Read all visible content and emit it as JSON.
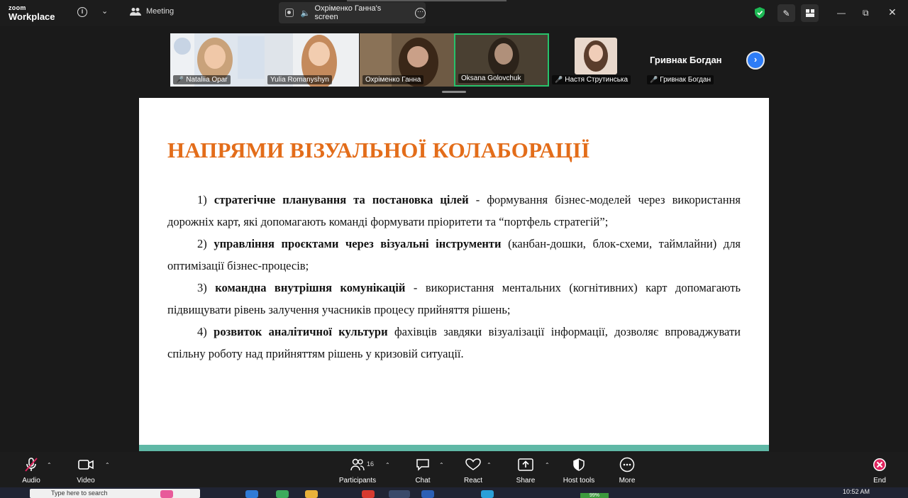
{
  "topbar": {
    "app_small": "zoom",
    "app_name": "Workplace",
    "meeting_label": "Meeting",
    "screen_title": "Охріменко Ганна's screen"
  },
  "gallery": {
    "tiles": [
      {
        "name": "Nataliia Opar",
        "muted": true
      },
      {
        "name": "Yulia Romanyshyn",
        "muted": false
      },
      {
        "name": "Охріменко Ганна",
        "muted": false
      },
      {
        "name": "Oksana Golovchuk",
        "muted": false
      },
      {
        "name": "Настя Струтинська",
        "muted": true
      },
      {
        "name": "Гривнак Богдан",
        "muted": true
      }
    ],
    "big_name": "Гривнак Богдан"
  },
  "slide": {
    "title": "НАПРЯМИ ВІЗУАЛЬНОЇ КОЛАБОРАЦІЇ",
    "items": [
      {
        "num": "1)",
        "bold": "стратегічне планування та постановка цілей",
        "rest": " - формування бізнес-моделей через використання дорожніх карт, які допомагають команді формувати пріоритети та “портфель стратегій”;"
      },
      {
        "num": "2)",
        "bold": "управління проєктами через візуальні інструменти",
        "rest": " (канбан-дошки, блок-схеми, таймлайни) для оптимізації бізнес-процесів;"
      },
      {
        "num": "3)",
        "bold": "командна внутрішня комунікацій",
        "rest": " - використання ментальних (когнітивних) карт допомагають підвищувати рівень залучення учасників процесу прийняття рішень;"
      },
      {
        "num": "4)",
        "bold": "розвиток аналітичної культури",
        "rest": " фахівців завдяки візуалізації інформації, дозволяє впроваджувати спільну роботу над прийняттям рішень у кризовій ситуації."
      }
    ],
    "title_color": "#e36d1a",
    "band_color": "#5fb8a6"
  },
  "toolbar": {
    "audio": "Audio",
    "video": "Video",
    "participants": "Participants",
    "participants_count": "16",
    "chat": "Chat",
    "react": "React",
    "share": "Share",
    "host_tools": "Host tools",
    "more": "More",
    "end": "End"
  },
  "taskbar": {
    "search_placeholder": "Type here to search",
    "battery": "99%",
    "time": "10:52 AM"
  },
  "colors": {
    "accent_green": "#27c26b",
    "shield_green": "#1db954",
    "end_red": "#e0245e",
    "next_blue": "#2d7cf6"
  }
}
